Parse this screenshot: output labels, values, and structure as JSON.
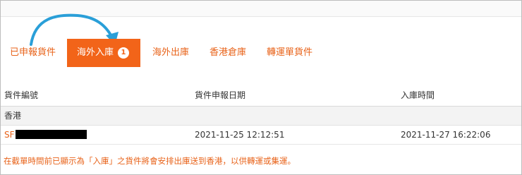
{
  "tabs": [
    {
      "label": "已申報貨件",
      "active": false
    },
    {
      "label": "海外入庫",
      "active": true,
      "badge": "1"
    },
    {
      "label": "海外出庫",
      "active": false
    },
    {
      "label": "香港倉庫",
      "active": false
    },
    {
      "label": "轉運單貨件",
      "active": false
    }
  ],
  "table": {
    "headers": [
      "貨件編號",
      "貨件申報日期",
      "入庫時間"
    ],
    "group_label": "香港",
    "rows": [
      {
        "id_prefix": "SF",
        "declared": "2021-11-25 12:12:51",
        "received": "2021-11-27 16:22:06"
      }
    ]
  },
  "note": "在截單時間前已顯示為「入庫」之貨件將會安排出庫送到香港，以供轉運或集運。",
  "colors": {
    "accent": "#f26419",
    "arrow": "#2a9fd8"
  },
  "icons": {
    "annotation": "curved-arrow-icon"
  }
}
